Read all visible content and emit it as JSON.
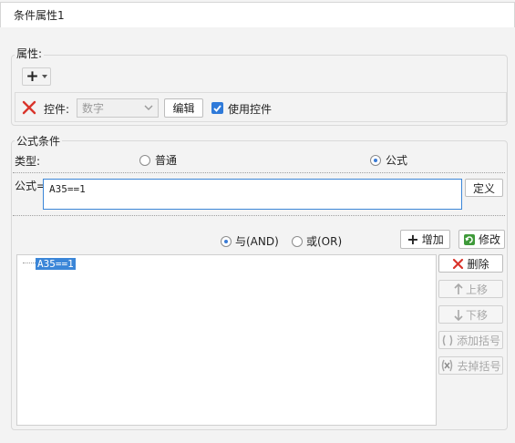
{
  "window": {
    "tab_title": "条件属性1"
  },
  "attributes": {
    "section_label": "属性:",
    "add_symbol": "+",
    "control_label": "控件:",
    "control_select_value": "数字",
    "edit_button": "编辑",
    "use_control_label": "使用控件",
    "use_control_checked": true
  },
  "formula_condition": {
    "section_label": "公式条件",
    "type_label": "类型:",
    "type_options": [
      {
        "label": "普通",
        "selected": false
      },
      {
        "label": "公式",
        "selected": true
      }
    ],
    "formula_label": "公式=",
    "formula_value": "A35==1",
    "define_button": "定义",
    "logic_options": [
      {
        "label": "与(AND)",
        "selected": true
      },
      {
        "label": "或(OR)",
        "selected": false
      }
    ],
    "add_button": "增加",
    "modify_button": "修改",
    "conditions": [
      "A35==1"
    ],
    "side_buttons": [
      {
        "label": "删除",
        "icon": "delete-x-icon",
        "enabled": true
      },
      {
        "label": "上移",
        "icon": "arrow-up-icon",
        "enabled": false
      },
      {
        "label": "下移",
        "icon": "arrow-down-icon",
        "enabled": false
      },
      {
        "label": "添加括号",
        "icon": "add-bracket-icon",
        "enabled": false
      },
      {
        "label": "去掉括号",
        "icon": "remove-bracket-icon",
        "enabled": false
      }
    ]
  },
  "colors": {
    "accent": "#3b86d8",
    "delete_red": "#d9342b",
    "background": "#f3f3f3"
  }
}
